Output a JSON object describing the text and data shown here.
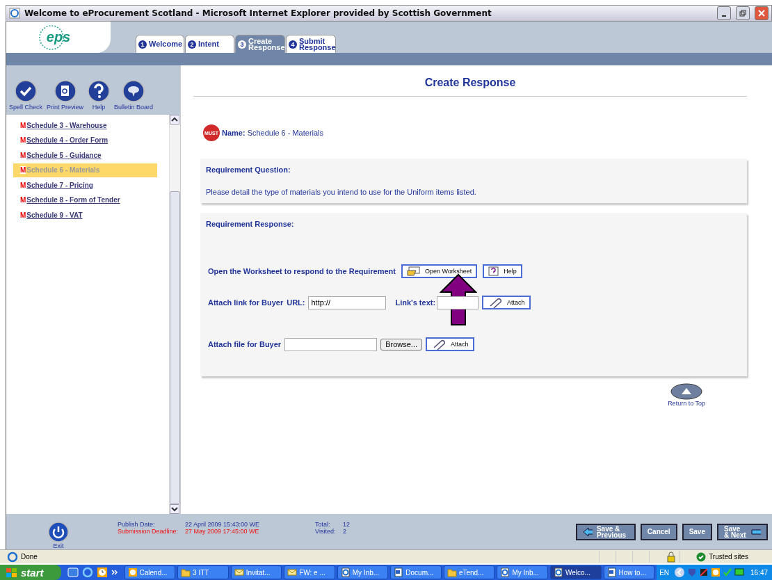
{
  "window": {
    "title": "Welcome to eProcurement Scotland - Microsoft Internet Explorer provided by Scottish Government"
  },
  "header": {
    "logo": "eps",
    "tabs": [
      {
        "number": "1",
        "label": "Welcome",
        "selected": false
      },
      {
        "number": "2",
        "label": "Intent",
        "selected": false
      },
      {
        "number": "3",
        "label": "Create Response",
        "selected": true
      },
      {
        "number": "4",
        "label": "Submit Response",
        "selected": false
      }
    ]
  },
  "toolbar": [
    {
      "kind": "spell",
      "label": "Spell Check"
    },
    {
      "kind": "preview",
      "label": "Print Preview"
    },
    {
      "kind": "help",
      "label": "Help"
    },
    {
      "kind": "bulletin",
      "label": "Bulletin Board"
    }
  ],
  "sidebar": {
    "items": [
      {
        "marker": "M",
        "label": "Schedule 3 - Warehouse",
        "selected": false
      },
      {
        "marker": "M",
        "label": "Schedule 4 - Order Form",
        "selected": false
      },
      {
        "marker": "M",
        "label": "Schedule 5 - Guidance",
        "selected": false
      },
      {
        "marker": "M",
        "label": "Schedule 6 - Materials",
        "selected": true
      },
      {
        "marker": "M",
        "label": "Schedule 7 - Pricing",
        "selected": false
      },
      {
        "marker": "M",
        "label": "Schedule 8 - Form of Tender",
        "selected": false
      },
      {
        "marker": "M",
        "label": "Schedule 9 - VAT",
        "selected": false
      }
    ]
  },
  "page": {
    "title": "Create Response",
    "name": {
      "badge": "MUST",
      "label": "Name:",
      "value": "Schedule 6 - Materials"
    },
    "question": {
      "heading": "Requirement Question:",
      "text": "Please detail the type of materials you intend to use for the Uniform items listed."
    },
    "response": {
      "heading": "Requirement Response:",
      "worksheet_label": "Open the Worksheet to respond to the Requirement",
      "open_worksheet_button": "Open Worksheet",
      "help_button": "Help",
      "link_label": "Attach link for Buyer",
      "url_label": "URL:",
      "url_value": "http://",
      "links_text_label": "Link's text:",
      "link_attach_button": "Attach",
      "file_label": "Attach file for Buyer",
      "browse_button": "Browse...",
      "file_attach_button": "Attach"
    },
    "return_to_top": "Return to Top"
  },
  "footer": {
    "exit": "Exit",
    "publish_label": "Publish Date:",
    "publish_value": "22 April 2009 15:43:00 WE",
    "deadline_label": "Submission Deadline:",
    "deadline_value": "27 May 2009 17:45:00 WE",
    "total_label": "Total:",
    "total_value": "12",
    "visited_label": "Visited:",
    "visited_value": "2",
    "buttons": [
      {
        "kind": "back",
        "label": "Save & Previous"
      },
      {
        "kind": "plain",
        "label": "Cancel"
      },
      {
        "kind": "plain",
        "label": "Save"
      },
      {
        "kind": "next",
        "label": "Save & Next"
      }
    ]
  },
  "status_bar": {
    "status": "Done",
    "zone": "Trusted sites"
  },
  "taskbar": {
    "start": "start",
    "items": [
      {
        "kind": "calendar",
        "label": "Calend...",
        "selected": false
      },
      {
        "kind": "folder",
        "label": "3 ITT",
        "selected": false
      },
      {
        "kind": "mail",
        "label": "Invitat...",
        "selected": false
      },
      {
        "kind": "mail",
        "label": "FW: e ...",
        "selected": false
      },
      {
        "kind": "browser",
        "label": "My Inb...",
        "selected": false
      },
      {
        "kind": "doc",
        "label": "Docum...",
        "selected": false
      },
      {
        "kind": "folder",
        "label": "eTend...",
        "selected": false
      },
      {
        "kind": "browser",
        "label": "My Inb...",
        "selected": false
      },
      {
        "kind": "browser",
        "label": "Welco...",
        "selected": true
      },
      {
        "kind": "doc",
        "label": "How to...",
        "selected": false
      }
    ],
    "lang": "EN",
    "clock": "16:47"
  }
}
